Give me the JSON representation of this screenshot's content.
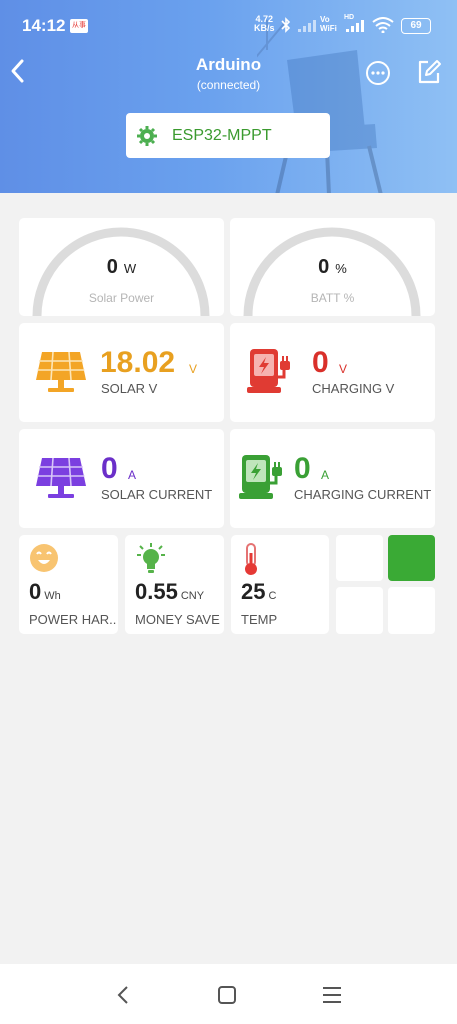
{
  "status_bar": {
    "time": "14:12",
    "badge": "从事",
    "net_speed_value": "4.72",
    "net_speed_unit": "KB/s",
    "signal_text": "Vo WiFi",
    "hd_text": "HD",
    "battery": "69"
  },
  "header": {
    "title": "Arduino",
    "subtitle": "(connected)",
    "device_name": "ESP32-MPPT"
  },
  "gauges": [
    {
      "value": "0",
      "unit": "W",
      "label": "Solar Power",
      "fraction": 0
    },
    {
      "value": "0",
      "unit": "%",
      "label": "BATT %",
      "fraction": 0
    }
  ],
  "metrics": [
    {
      "value": "18.02",
      "unit": "V",
      "label": "SOLAR V",
      "color": "#e8a020",
      "icon": "solar-panel-icon"
    },
    {
      "value": "0",
      "unit": "V",
      "label": "CHARGING V",
      "color": "#d9302a",
      "icon": "ev-charger-icon"
    },
    {
      "value": "0",
      "unit": "A",
      "label": "SOLAR CURRENT",
      "color": "#6b2fc9",
      "icon": "solar-panel-icon"
    },
    {
      "value": "0",
      "unit": "A",
      "label": "CHARGING CURRENT",
      "color": "#3aa035",
      "icon": "ev-charger-icon"
    }
  ],
  "small_stats": [
    {
      "value": "0",
      "unit": "Wh",
      "label": "POWER HAR..",
      "icon": "smiley-icon"
    },
    {
      "value": "0.55",
      "unit": "CNY",
      "label": "MONEY SAVE",
      "icon": "lightbulb-icon"
    },
    {
      "value": "25",
      "unit": "C",
      "label": "TEMP",
      "icon": "thermometer-icon"
    }
  ],
  "buttons": [
    {
      "state": "off"
    },
    {
      "state": "on",
      "color": "#3aaa35"
    },
    {
      "state": "off"
    },
    {
      "state": "off"
    }
  ]
}
